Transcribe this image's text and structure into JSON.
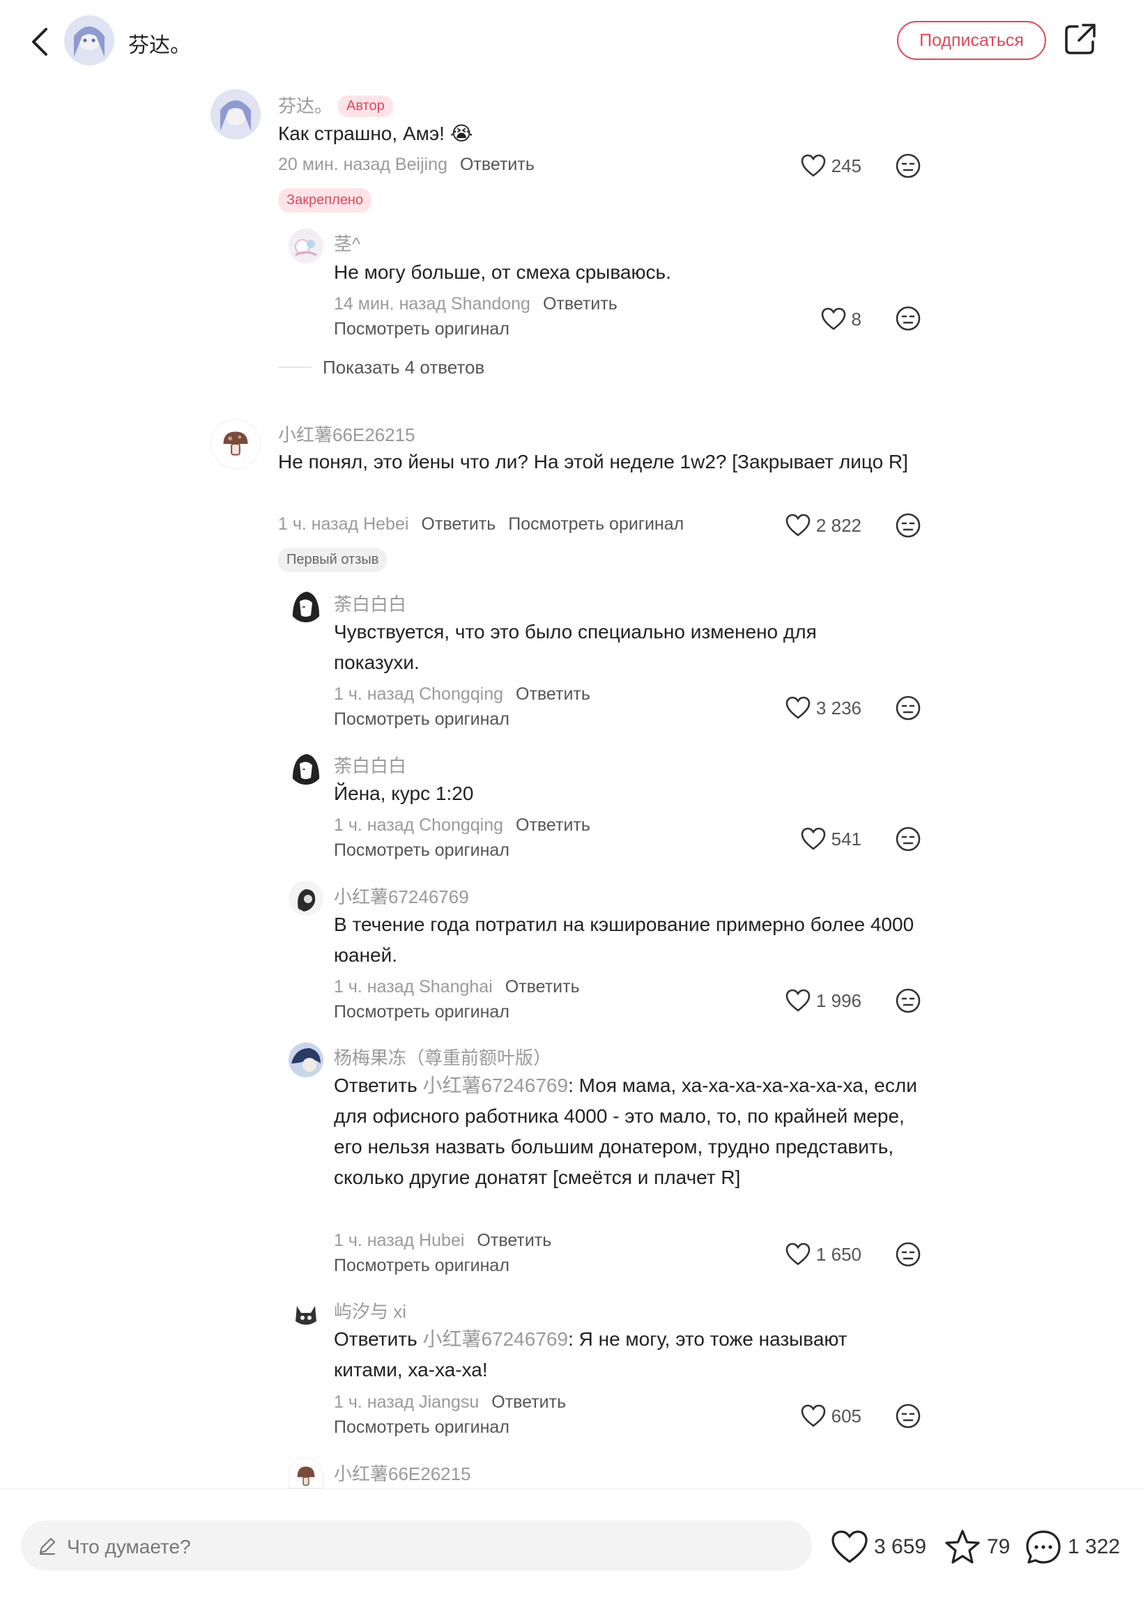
{
  "header": {
    "name": "芬达。",
    "subscribe_label": "Подписаться"
  },
  "comments": [
    {
      "user": "芬达。",
      "badge": "Автор",
      "text": "Как страшно, Амэ! 😭",
      "time_loc": "20 мин. назад Beijing",
      "reply": "Ответить",
      "likes": "245",
      "tag": "Закреплено",
      "replies": [
        {
          "user": "茎^",
          "text": "Не могу больше, от смеха срываюсь.",
          "time_loc": "14 мин. назад Shandong",
          "reply": "Ответить",
          "view_original": "Посмотреть оригинал",
          "likes": "8"
        }
      ],
      "show_more": "Показать 4 ответов"
    },
    {
      "user": "小红薯66E26215",
      "text": "Не понял, это йены что ли? На этой неделе 1w2? [Закрывает лицо R]",
      "time_loc": "1 ч. назад Hebei",
      "reply": "Ответить",
      "view_original": "Посмотреть оригинал",
      "likes": "2 822",
      "tag": "Первый отзыв",
      "replies": [
        {
          "user": "荼白白白",
          "text": "Чувствуется, что это было специально изменено для показухи.",
          "time_loc": "1 ч. назад Chongqing",
          "reply": "Ответить",
          "view_original": "Посмотреть оригинал",
          "likes": "3 236"
        },
        {
          "user": "荼白白白",
          "text": "Йена, курс 1:20",
          "time_loc": "1 ч. назад Chongqing",
          "reply": "Ответить",
          "view_original": "Посмотреть оригинал",
          "likes": "541"
        },
        {
          "user": "小红薯67246769",
          "text": "В течение года потратил на кэширование примерно более 4000 юаней.",
          "time_loc": "1 ч. назад Shanghai",
          "reply": "Ответить",
          "view_original": "Посмотреть оригинал",
          "likes": "1 996"
        },
        {
          "user": "杨梅果冻（尊重前额叶版）",
          "reply_prefix": "Ответить",
          "mention": "小红薯67246769",
          "text": ": Моя мама, ха-ха-ха-ха-ха-ха-ха, если для офисного работника 4000 - это мало, то, по крайней мере, его нельзя назвать большим донатером, трудно представить, сколько другие донатят [смеётся и плачет R]",
          "time_loc": "1 ч. назад Hubei",
          "reply": "Ответить",
          "view_original": "Посмотреть оригинал",
          "likes": "1 650"
        },
        {
          "user": "屿汐与 xi",
          "reply_prefix": "Ответить",
          "mention": "小红薯67246769",
          "text": ": Я не могу, это тоже называют китами, ха-ха-ха!",
          "time_loc": "1 ч. назад Jiangsu",
          "reply": "Ответить",
          "view_original": "Посмотреть оригинал",
          "likes": "605"
        },
        {
          "user": "小红薯66E26215"
        }
      ]
    }
  ],
  "bottom": {
    "placeholder": "Что думаете?",
    "likes": "3 659",
    "stars": "79",
    "comments": "1 322"
  },
  "colors": {
    "accent": "#e0475a",
    "muted": "#9a9a9a"
  },
  "icons": [
    "back-icon",
    "share-icon",
    "heart-icon",
    "dislike-icon",
    "pen-icon",
    "star-icon",
    "comment-bubble-icon"
  ]
}
